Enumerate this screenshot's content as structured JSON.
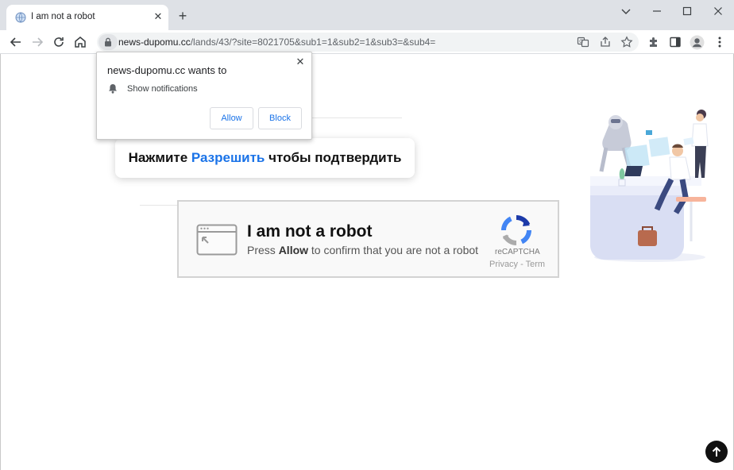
{
  "browser": {
    "tab": {
      "title": "I am not a robot"
    },
    "address_bar": {
      "host": "news-dupomu.cc",
      "path": "/lands/43/?site=8021705&sub1=1&sub2=1&sub3=&sub4="
    }
  },
  "notification_prompt": {
    "title": "news-dupomu.cc wants to",
    "permission": "Show notifications",
    "allow_label": "Allow",
    "block_label": "Block"
  },
  "page": {
    "instruction": {
      "prefix": "Нажмите ",
      "accent": "Разрешить",
      "suffix": " чтобы подтвердить",
      "accent_color": "#1a73e8"
    },
    "captcha": {
      "title": "I am not a robot",
      "subtitle_prefix": "Press ",
      "subtitle_bold": "Allow",
      "subtitle_suffix": " to confirm that you are not a robot",
      "brand": "reCAPTCHA",
      "links": "Privacy - Terms"
    }
  },
  "icons": {
    "tab_favicon": "globe-icon",
    "tab_close": "close-icon",
    "new_tab": "plus-icon",
    "back": "arrow-left-icon",
    "forward": "arrow-right-icon",
    "reload": "reload-icon",
    "home": "home-icon",
    "site_info": "lock-icon",
    "translate": "translate-icon",
    "share": "share-icon",
    "bookmark": "star-icon",
    "extensions": "puzzle-icon",
    "side_panel": "side-panel-icon",
    "profile": "profile-icon",
    "menu": "kebab-menu-icon",
    "scroll_top": "arrow-up-icon"
  }
}
